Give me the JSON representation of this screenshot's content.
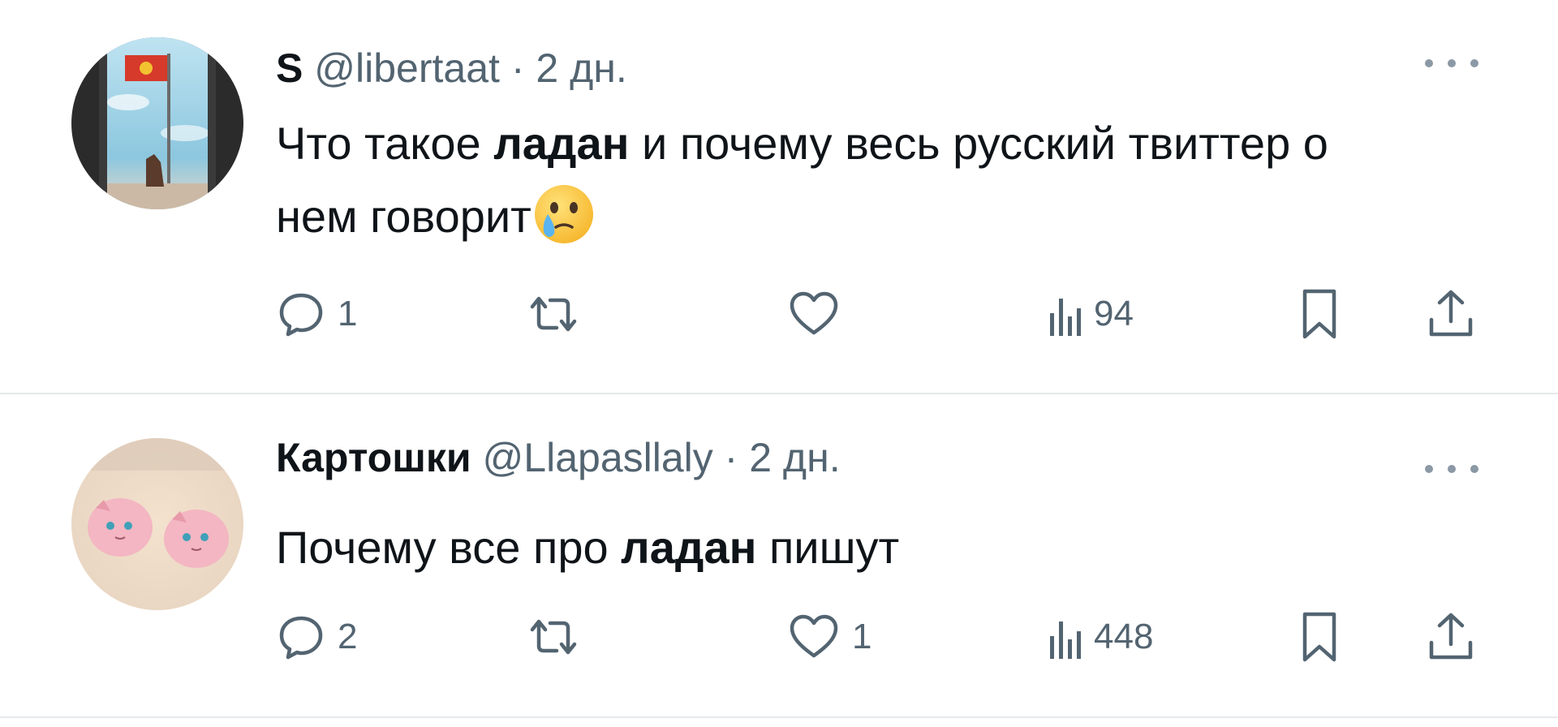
{
  "tweets": [
    {
      "display_name": "S",
      "handle": "@libertaat",
      "separator": "·",
      "time": "2 дн.",
      "text_parts": [
        "Что такое ",
        "ладан",
        " и почему весь русский твиттер о нем говорит"
      ],
      "emoji": "face-holding-back-tears",
      "counts": {
        "reply": "1",
        "retweet": "",
        "like": "",
        "views": "94"
      }
    },
    {
      "display_name": "Картошки",
      "handle": "@Llapasllaly",
      "separator": "·",
      "time": "2 дн.",
      "text_parts": [
        "Почему все про ",
        "ладан",
        " пишут"
      ],
      "counts": {
        "reply": "2",
        "retweet": "",
        "like": "1",
        "views": "448"
      }
    }
  ],
  "icons": {
    "reply": "speech-bubble-icon",
    "retweet": "retweet-arrows-icon",
    "like": "heart-icon",
    "views": "bar-chart-icon",
    "bookmark": "bookmark-icon",
    "share": "share-upload-icon",
    "more": "ellipsis-icon"
  },
  "colors": {
    "text_primary": "#0f1419",
    "text_secondary": "#536471",
    "divider": "#e6e9eb",
    "background": "#ffffff"
  }
}
